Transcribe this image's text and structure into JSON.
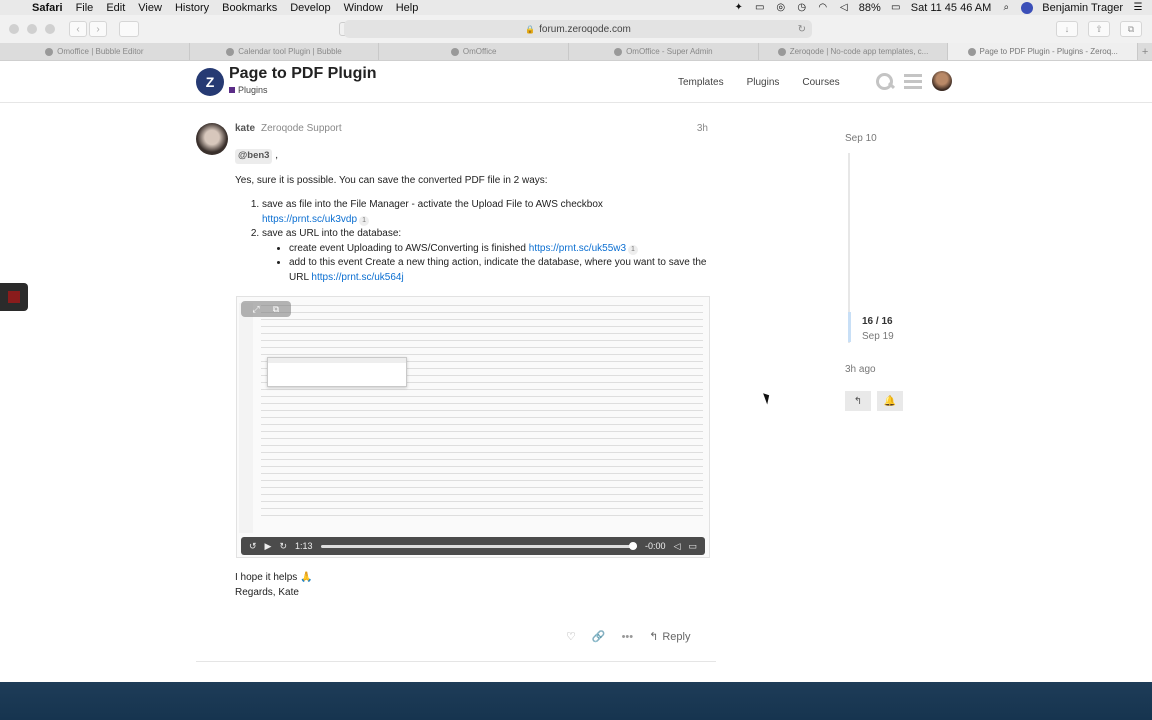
{
  "menubar": {
    "app": "Safari",
    "items": [
      "File",
      "Edit",
      "View",
      "History",
      "Bookmarks",
      "Develop",
      "Window",
      "Help"
    ],
    "battery": "88%",
    "clock": "Sat 11 45 46 AM",
    "user": "Benjamin Trager"
  },
  "browser": {
    "url": "forum.zeroqode.com",
    "tabs": [
      {
        "label": "Omoffice | Bubble Editor",
        "active": false
      },
      {
        "label": "Calendar tool Plugin | Bubble",
        "active": false
      },
      {
        "label": "OmOffice",
        "active": false
      },
      {
        "label": "OmOffice - Super Admin",
        "active": false
      },
      {
        "label": "Zeroqode | No-code app templates, c...",
        "active": false
      },
      {
        "label": "Page to PDF Plugin - Plugins - Zeroq...",
        "active": true
      }
    ]
  },
  "header": {
    "logo": "Z",
    "title": "Page to PDF Plugin",
    "category": "Plugins",
    "nav": [
      "Templates",
      "Plugins",
      "Courses"
    ]
  },
  "post": {
    "username": "kate",
    "flair": "Zeroqode Support",
    "time": "3h",
    "mention": "@ben3",
    "mention_suffix": " ,",
    "intro": "Yes, sure it is possible. You can save the converted PDF file in 2 ways:",
    "step1_text": "save as file into the File Manager - activate the Upload File to AWS checkbox",
    "step1_link": "https://prnt.sc/uk3vdp",
    "step1_count": "1",
    "step2_text": "save as URL into the database:",
    "sub1_text": "create event Uploading to AWS/Converting is finished ",
    "sub1_link": "https://prnt.sc/uk55w3",
    "sub1_count": "1",
    "sub2_text": "add to this event Create a new thing action, indicate the database, where you want to save the URL ",
    "sub2_link": "https://prnt.sc/uk564j",
    "video_time": "1:13",
    "video_remaining": "-0:00",
    "closing1": "I hope it helps 🙏",
    "closing2": "Regards, Kate",
    "reply_label": "Reply"
  },
  "timeline": {
    "start": "Sep 10",
    "count": "16 / 16",
    "date": "Sep 19",
    "ago": "3h ago"
  }
}
